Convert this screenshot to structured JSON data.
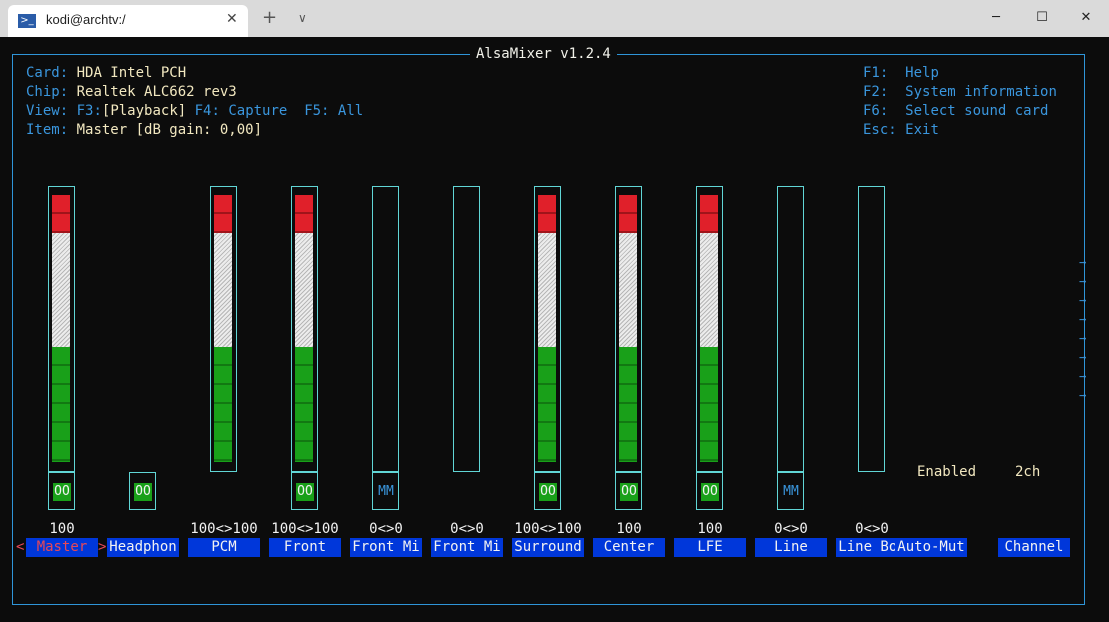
{
  "window": {
    "tab_title": "kodi@archtv:/",
    "tab_icon": ">_",
    "close_glyph": "✕",
    "new_tab_glyph": "+",
    "dropdown_glyph": "∨",
    "minimize_glyph": "─",
    "maximize_glyph": "☐",
    "close_window_glyph": "✕"
  },
  "mixer": {
    "title": "AlsaMixer v1.2.4",
    "info": {
      "card_label": "Card:",
      "card_value": "HDA Intel PCH",
      "chip_label": "Chip:",
      "chip_value": "Realtek ALC662 rev3",
      "view_label": "View:",
      "view_f3": "F3:",
      "view_playback": "[Playback]",
      "view_f4": "F4: Capture",
      "view_f5": "F5: All",
      "item_label": "Item:",
      "item_value": "Master [dB gain: 0,00]"
    },
    "help": [
      {
        "key": "F1:",
        "text": "Help"
      },
      {
        "key": "F2:",
        "text": "System information"
      },
      {
        "key": "F6:",
        "text": "Select sound card"
      },
      {
        "key": "Esc:",
        "text": "Exit"
      }
    ],
    "channels": [
      {
        "label": "Master",
        "level": "100",
        "level_percent": 100,
        "switch": "OO",
        "selected": true,
        "cursor_left": "<",
        "cursor_right": ">"
      },
      {
        "label": "Headphon",
        "level": "",
        "switch": "OO"
      },
      {
        "label": "PCM",
        "level": "100<>100",
        "level_percent": 100,
        "switch": ""
      },
      {
        "label": "Front",
        "level": "100<>100",
        "level_percent": 100,
        "switch": "OO"
      },
      {
        "label": "Front Mi",
        "level": "0<>0",
        "level_percent": 0,
        "switch": "MM"
      },
      {
        "label": "Front Mi",
        "level": "0<>0",
        "level_percent": 0,
        "switch": ""
      },
      {
        "label": "Surround",
        "level": "100<>100",
        "level_percent": 100,
        "switch": "OO"
      },
      {
        "label": "Center",
        "level": "100",
        "level_percent": 100,
        "switch": "OO"
      },
      {
        "label": "LFE",
        "level": "100",
        "level_percent": 100,
        "switch": "OO"
      },
      {
        "label": "Line",
        "level": "0<>0",
        "level_percent": 0,
        "switch": "MM"
      },
      {
        "label": "Line Boo",
        "level": "0<>0",
        "level_percent": 0,
        "switch": ""
      },
      {
        "label": "Auto-Mut",
        "value": "Enabled"
      },
      {
        "label": "Channel",
        "value": "2ch"
      }
    ],
    "more_arrow": "→",
    "colors": {
      "red": "#e0202a",
      "white": "#ececec",
      "green": "#19a019",
      "label_bg": "#0037da",
      "frame": "#2f95d8"
    }
  }
}
